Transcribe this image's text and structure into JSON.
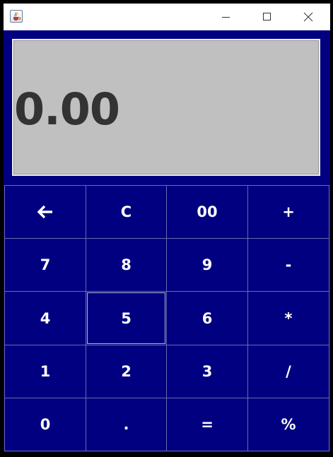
{
  "window": {
    "app_icon": "java-cup-icon",
    "controls": [
      "minimize-icon",
      "maximize-icon",
      "close-icon"
    ]
  },
  "display": {
    "value": "0.00"
  },
  "keys": {
    "backspace": {
      "icon": "backspace-arrow-icon"
    },
    "clear": "C",
    "double_zero": "00",
    "plus": "+",
    "seven": "7",
    "eight": "8",
    "nine": "9",
    "minus": "-",
    "four": "4",
    "five": "5",
    "six": "6",
    "multiply": "*",
    "one": "1",
    "two": "2",
    "three": "3",
    "divide": "/",
    "zero": "0",
    "decimal": ".",
    "equals": "=",
    "percent": "%"
  },
  "colors": {
    "panel_background": "#000080",
    "display_background": "#C0C0C0",
    "display_text": "#333333",
    "key_text": "#FFFFFF",
    "titlebar": "#FFFFFF"
  }
}
